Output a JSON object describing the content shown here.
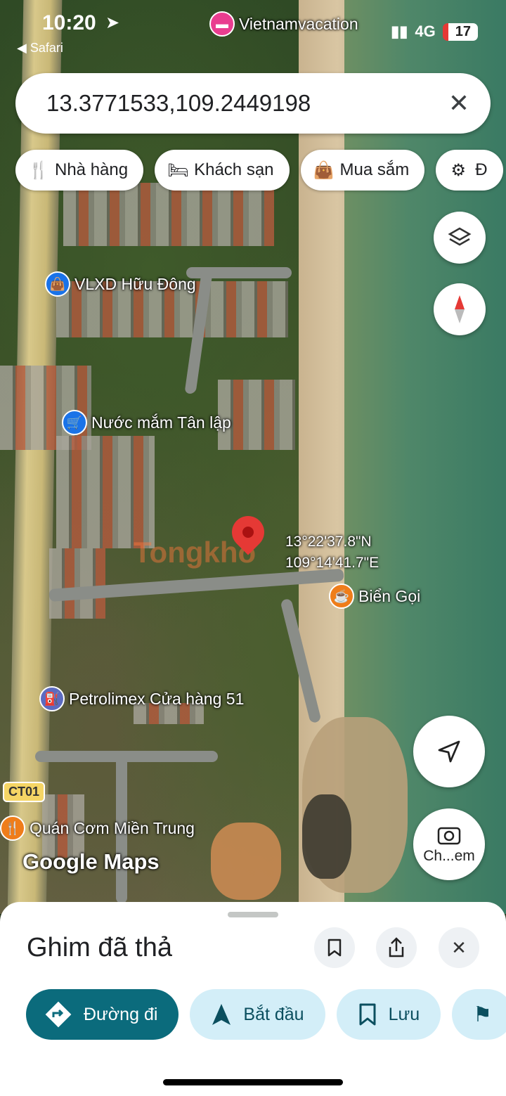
{
  "status_bar": {
    "time": "10:20",
    "back_app": "◀ Safari",
    "network": "4G",
    "battery": "17"
  },
  "map_labels": {
    "top_poi": "Vietnamvacation",
    "poi_1": "VLXD Hữu Đông",
    "poi_2": "Nước mắm Tân lập",
    "poi_3": "Biển Gọi",
    "poi_4": "Petrolimex Cửa hàng 51",
    "poi_5": "Quán Cơm Miền Trung",
    "pin_lat": "13°22'37.8\"N",
    "pin_lng": "109°14'41.7\"E",
    "road_badge": "CT01",
    "attribution": "Google Maps",
    "watermark": "Tongkho"
  },
  "search": {
    "value": "13.3771533,109.2449198"
  },
  "chips": [
    {
      "label": "Nhà hàng",
      "icon": "restaurant-icon"
    },
    {
      "label": "Khách sạn",
      "icon": "hotel-icon"
    },
    {
      "label": "Mua sắm",
      "icon": "shopping-bag-icon"
    },
    {
      "label": "Đ",
      "icon": "attractions-icon"
    }
  ],
  "camera_button": {
    "label": "Ch...em"
  },
  "sheet": {
    "title": "Ghim đã thả",
    "actions": [
      {
        "label": "Đường đi"
      },
      {
        "label": "Bắt đầu"
      },
      {
        "label": "Lưu"
      }
    ]
  },
  "colors": {
    "primary": "#0b6b7c",
    "secondary": "#d3eef8",
    "pin": "#e53935"
  }
}
